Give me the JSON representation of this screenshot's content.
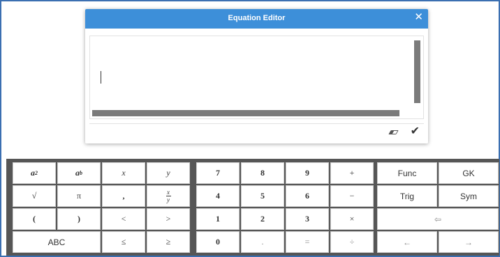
{
  "dialog": {
    "title": "Equation Editor",
    "close_glyph": "✕"
  },
  "footer": {
    "eraser_icon": "eraser-icon",
    "check_glyph": "✔"
  },
  "keyboard": {
    "math_keys": [
      {
        "label": "a",
        "sup": "2"
      },
      {
        "label": "a",
        "sup": "b"
      },
      {
        "label": "x"
      },
      {
        "label": "y"
      },
      {
        "label": "√"
      },
      {
        "label": "π"
      },
      {
        "label": ","
      },
      {
        "label": "x/y",
        "num": "x",
        "den": "y"
      },
      {
        "label": "("
      },
      {
        "label": ")"
      },
      {
        "label": "<"
      },
      {
        "label": ">"
      },
      {
        "label": "ABC"
      },
      {
        "label": "≤"
      },
      {
        "label": "≥"
      }
    ],
    "num_keys": [
      "7",
      "8",
      "9",
      "+",
      "4",
      "5",
      "6",
      "−",
      "1",
      "2",
      "3",
      "×",
      "0",
      ".",
      "=",
      "÷"
    ],
    "func_keys": [
      "Func",
      "GK",
      "Trig",
      "Sym",
      "⇦",
      "←",
      "→"
    ]
  }
}
